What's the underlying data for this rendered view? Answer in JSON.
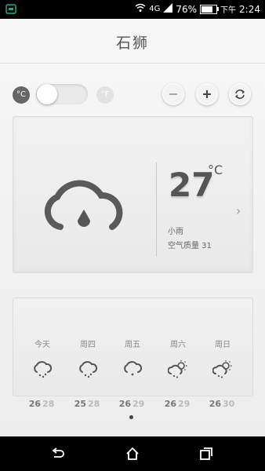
{
  "status_bar": {
    "network": "4G",
    "battery": "76%",
    "battery_level": 0.76,
    "time_period": "下午",
    "time": "2:24"
  },
  "app": {
    "city": "石狮"
  },
  "toolbar": {
    "unit_c": "°C",
    "unit_f": "°F",
    "minus_icon": "minus-icon",
    "plus_icon": "plus-icon",
    "refresh_icon": "refresh-icon"
  },
  "current": {
    "icon": "cloud-rain-icon",
    "temperature": "27",
    "unit": "°C",
    "condition": "小雨",
    "air_quality": "空气质量 31"
  },
  "forecast": {
    "days": [
      {
        "label": "今天",
        "icon": "cloud-drizzle-icon",
        "low": "26",
        "high": "28"
      },
      {
        "label": "周四",
        "icon": "cloud-drizzle-icon",
        "low": "25",
        "high": "28"
      },
      {
        "label": "周五",
        "icon": "cloud-drizzle-icon",
        "low": "26",
        "high": "29"
      },
      {
        "label": "周六",
        "icon": "sun-cloud-rain-icon",
        "low": "26",
        "high": "29"
      },
      {
        "label": "周日",
        "icon": "sun-cloud-rain-icon",
        "low": "26",
        "high": "30"
      }
    ]
  },
  "nav_bar": {
    "back_icon": "back-icon",
    "home_icon": "home-icon",
    "recents_icon": "recents-icon"
  }
}
